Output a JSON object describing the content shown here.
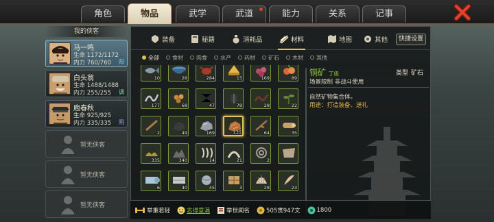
{
  "tabs": [
    {
      "label": "角色"
    },
    {
      "label": "物品"
    },
    {
      "label": "武学"
    },
    {
      "label": "武道",
      "badge": true
    },
    {
      "label": "能力"
    },
    {
      "label": "关系"
    },
    {
      "label": "记事"
    }
  ],
  "active_tab": "物品",
  "sidebar": {
    "title": "我的侠客",
    "characters": [
      {
        "name": "马一鸣",
        "hp_label": "生命",
        "hp": "1172/1172",
        "mp_label": "内力",
        "mp": "760/760",
        "tag": "阳",
        "tag_color": "#7fc6e8",
        "selected": true
      },
      {
        "name": "白头翁",
        "hp_label": "生命",
        "hp": "1488/1488",
        "mp_label": "内力",
        "mp": "255/255",
        "tag": "调",
        "tag_color": "#7fd49a",
        "selected": false
      },
      {
        "name": "庖春秋",
        "hp_label": "生命",
        "hp": "925/925",
        "mp_label": "内力",
        "mp": "335/335",
        "tag": "阴",
        "tag_color": "#a6b0e8",
        "selected": false
      }
    ],
    "empty_label": "暂无侠客"
  },
  "categories": [
    {
      "label": "装备",
      "icon": "equipment-icon"
    },
    {
      "label": "秘籍",
      "icon": "manual-book-icon"
    },
    {
      "label": "消耗品",
      "icon": "potion-icon"
    },
    {
      "label": "材料",
      "icon": "material-icon",
      "active": true
    },
    {
      "label": "地图",
      "icon": "map-icon"
    },
    {
      "label": "其他",
      "icon": "misc-icon"
    }
  ],
  "quick_settings": "快捷设置",
  "filters": [
    {
      "label": "全部",
      "active": true
    },
    {
      "label": "食材"
    },
    {
      "label": "肉食"
    },
    {
      "label": "水产"
    },
    {
      "label": "药材"
    },
    {
      "label": "矿石"
    },
    {
      "label": "木材"
    },
    {
      "label": "其他"
    }
  ],
  "items": [
    {
      "count": "10",
      "icon": "fish-icon"
    },
    {
      "count": "28",
      "icon": "bowl-icon"
    },
    {
      "count": "284",
      "icon": "crab-icon"
    },
    {
      "count": "15",
      "icon": "grain-icon"
    },
    {
      "count": "169",
      "icon": "berries-icon"
    },
    {
      "count": "89",
      "icon": "fruit-icon"
    },
    {
      "count": "177",
      "icon": "snake-icon"
    },
    {
      "count": "68",
      "icon": "seeds-icon"
    },
    {
      "count": "47",
      "icon": "spider-icon"
    },
    {
      "count": "78",
      "icon": "beetle-icon"
    },
    {
      "count": "28",
      "icon": "worm-icon"
    },
    {
      "count": "22",
      "icon": "herb-icon"
    },
    {
      "count": "2",
      "icon": "stick-icon"
    },
    {
      "count": "49",
      "icon": "coal-icon"
    },
    {
      "count": "169",
      "icon": "iron-ore-icon"
    },
    {
      "count": "135",
      "icon": "copper-ore-icon",
      "selected": true
    },
    {
      "count": "64",
      "icon": "branch-icon"
    },
    {
      "count": "35",
      "icon": "log-icon"
    },
    {
      "count": "335",
      "icon": "moss-icon"
    },
    {
      "count": "340",
      "icon": "rock-pile-icon"
    },
    {
      "count": "14",
      "icon": "claw-icon"
    },
    {
      "count": "21",
      "icon": "horn-icon"
    },
    {
      "count": "2",
      "icon": "coil-icon"
    },
    {
      "count": "",
      "icon": "cloth-icon"
    },
    {
      "count": "6",
      "icon": "cloth-roll-icon"
    },
    {
      "count": "40",
      "icon": "silk-icon"
    },
    {
      "count": "45",
      "icon": "ball-icon"
    },
    {
      "count": "3",
      "icon": "bundle-icon"
    },
    {
      "count": "28",
      "icon": "shell-icon"
    },
    {
      "count": "23",
      "icon": "feather-icon"
    }
  ],
  "detail": {
    "name": "铜矿",
    "grade": "丁级",
    "type_label": "类型",
    "type": "矿石",
    "scene": "场景限制  非战斗使用",
    "description": "自然矿物集合体。",
    "usage": "用途：打造装备、送礼"
  },
  "bottom": {
    "weight": "举重若轻",
    "mood": "志得意满",
    "fame": "举世闻名",
    "money": "505贯947文",
    "gems": "1800"
  },
  "colors": {
    "accent": "#d4c28a",
    "item_border": "#7a9a3a",
    "selected_border": "#e7c45a",
    "item_name": "#8ec63f",
    "usage": "#e6b84a"
  }
}
